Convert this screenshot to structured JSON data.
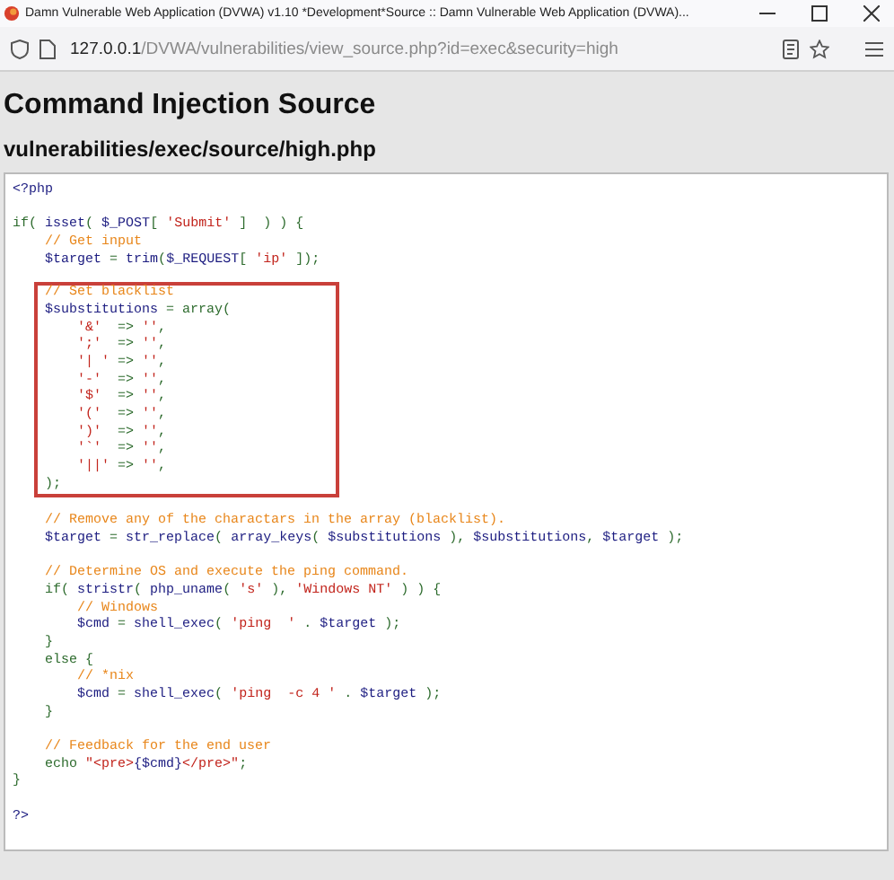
{
  "window": {
    "title": "Damn Vulnerable Web Application (DVWA) v1.10 *Development*Source :: Damn Vulnerable Web Application (DVWA)..."
  },
  "address_bar": {
    "host": "127.0.0.1",
    "path": "/DVWA/vulnerabilities/view_source.php?id=exec&security=high"
  },
  "page": {
    "heading": "Command Injection Source",
    "file_path": "vulnerabilities/exec/source/high.php"
  },
  "code": {
    "blocks": [
      {
        "kind": "plain",
        "lines": [
          {
            "tokens": [
              {
                "kind": "code",
                "text": "<?php"
              }
            ]
          },
          {
            "gap_before": true,
            "tokens": [
              {
                "kind": "keyword",
                "text": "if( "
              },
              {
                "kind": "code",
                "text": "isset"
              },
              {
                "kind": "keyword",
                "text": "( "
              },
              {
                "kind": "code",
                "text": "$_POST"
              },
              {
                "kind": "keyword",
                "text": "[ "
              },
              {
                "kind": "string",
                "text": "'Submit'"
              },
              {
                "kind": "keyword",
                "text": " ]  ) ) {"
              }
            ]
          },
          {
            "tokens": [
              {
                "kind": "comment",
                "text": "    // Get input"
              }
            ]
          },
          {
            "tokens": [
              {
                "kind": "code",
                "text": "    $target "
              },
              {
                "kind": "keyword",
                "text": "= "
              },
              {
                "kind": "code",
                "text": "trim"
              },
              {
                "kind": "keyword",
                "text": "("
              },
              {
                "kind": "code",
                "text": "$_REQUEST"
              },
              {
                "kind": "keyword",
                "text": "[ "
              },
              {
                "kind": "string",
                "text": "'ip'"
              },
              {
                "kind": "keyword",
                "text": " ]);"
              }
            ]
          }
        ]
      },
      {
        "kind": "boxed",
        "gap_before": true,
        "lines": [
          {
            "tokens": [
              {
                "kind": "comment",
                "text": "    // Set blacklist"
              }
            ]
          },
          {
            "tokens": [
              {
                "kind": "code",
                "text": "    $substitutions "
              },
              {
                "kind": "keyword",
                "text": "= array("
              }
            ]
          },
          {
            "tokens": [
              {
                "kind": "string",
                "text": "        '&'"
              },
              {
                "kind": "keyword",
                "text": "  => "
              },
              {
                "kind": "string",
                "text": "''"
              },
              {
                "kind": "keyword",
                "text": ","
              }
            ]
          },
          {
            "tokens": [
              {
                "kind": "string",
                "text": "        ';'"
              },
              {
                "kind": "keyword",
                "text": "  => "
              },
              {
                "kind": "string",
                "text": "''"
              },
              {
                "kind": "keyword",
                "text": ","
              }
            ]
          },
          {
            "tokens": [
              {
                "kind": "string",
                "text": "        '| '"
              },
              {
                "kind": "keyword",
                "text": " => "
              },
              {
                "kind": "string",
                "text": "''"
              },
              {
                "kind": "keyword",
                "text": ","
              }
            ]
          },
          {
            "tokens": [
              {
                "kind": "string",
                "text": "        '-'"
              },
              {
                "kind": "keyword",
                "text": "  => "
              },
              {
                "kind": "string",
                "text": "''"
              },
              {
                "kind": "keyword",
                "text": ","
              }
            ]
          },
          {
            "tokens": [
              {
                "kind": "string",
                "text": "        '$'"
              },
              {
                "kind": "keyword",
                "text": "  => "
              },
              {
                "kind": "string",
                "text": "''"
              },
              {
                "kind": "keyword",
                "text": ","
              }
            ]
          },
          {
            "tokens": [
              {
                "kind": "string",
                "text": "        '('"
              },
              {
                "kind": "keyword",
                "text": "  => "
              },
              {
                "kind": "string",
                "text": "''"
              },
              {
                "kind": "keyword",
                "text": ","
              }
            ]
          },
          {
            "tokens": [
              {
                "kind": "string",
                "text": "        ')'"
              },
              {
                "kind": "keyword",
                "text": "  => "
              },
              {
                "kind": "string",
                "text": "''"
              },
              {
                "kind": "keyword",
                "text": ","
              }
            ]
          },
          {
            "tokens": [
              {
                "kind": "string",
                "text": "        '`'"
              },
              {
                "kind": "keyword",
                "text": "  => "
              },
              {
                "kind": "string",
                "text": "''"
              },
              {
                "kind": "keyword",
                "text": ","
              }
            ]
          },
          {
            "tokens": [
              {
                "kind": "string",
                "text": "        '||'"
              },
              {
                "kind": "keyword",
                "text": " => "
              },
              {
                "kind": "string",
                "text": "''"
              },
              {
                "kind": "keyword",
                "text": ","
              }
            ]
          },
          {
            "tokens": [
              {
                "kind": "keyword",
                "text": "    );"
              }
            ]
          }
        ]
      },
      {
        "kind": "plain",
        "gap_before": true,
        "lines": [
          {
            "tokens": [
              {
                "kind": "comment",
                "text": "    // Remove any of the charactars in the array (blacklist)."
              }
            ]
          },
          {
            "tokens": [
              {
                "kind": "code",
                "text": "    $target "
              },
              {
                "kind": "keyword",
                "text": "= "
              },
              {
                "kind": "code",
                "text": "str_replace"
              },
              {
                "kind": "keyword",
                "text": "( "
              },
              {
                "kind": "code",
                "text": "array_keys"
              },
              {
                "kind": "keyword",
                "text": "( "
              },
              {
                "kind": "code",
                "text": "$substitutions "
              },
              {
                "kind": "keyword",
                "text": "), "
              },
              {
                "kind": "code",
                "text": "$substitutions"
              },
              {
                "kind": "keyword",
                "text": ", "
              },
              {
                "kind": "code",
                "text": "$target "
              },
              {
                "kind": "keyword",
                "text": ");"
              }
            ]
          },
          {
            "gap_before": true,
            "tokens": [
              {
                "kind": "comment",
                "text": "    // Determine OS and execute the ping command."
              }
            ]
          },
          {
            "tokens": [
              {
                "kind": "keyword",
                "text": "    if( "
              },
              {
                "kind": "code",
                "text": "stristr"
              },
              {
                "kind": "keyword",
                "text": "( "
              },
              {
                "kind": "code",
                "text": "php_uname"
              },
              {
                "kind": "keyword",
                "text": "( "
              },
              {
                "kind": "string",
                "text": "'s'"
              },
              {
                "kind": "keyword",
                "text": " ), "
              },
              {
                "kind": "string",
                "text": "'Windows NT'"
              },
              {
                "kind": "keyword",
                "text": " ) ) {"
              }
            ]
          },
          {
            "tokens": [
              {
                "kind": "comment",
                "text": "        // Windows"
              }
            ]
          },
          {
            "tokens": [
              {
                "kind": "code",
                "text": "        $cmd "
              },
              {
                "kind": "keyword",
                "text": "= "
              },
              {
                "kind": "code",
                "text": "shell_exec"
              },
              {
                "kind": "keyword",
                "text": "( "
              },
              {
                "kind": "string",
                "text": "'ping  '"
              },
              {
                "kind": "keyword",
                "text": " . "
              },
              {
                "kind": "code",
                "text": "$target "
              },
              {
                "kind": "keyword",
                "text": ");"
              }
            ]
          },
          {
            "tokens": [
              {
                "kind": "keyword",
                "text": "    }"
              }
            ]
          },
          {
            "tokens": [
              {
                "kind": "keyword",
                "text": "    else {"
              }
            ]
          },
          {
            "tokens": [
              {
                "kind": "comment",
                "text": "        // *nix"
              }
            ]
          },
          {
            "tokens": [
              {
                "kind": "code",
                "text": "        $cmd "
              },
              {
                "kind": "keyword",
                "text": "= "
              },
              {
                "kind": "code",
                "text": "shell_exec"
              },
              {
                "kind": "keyword",
                "text": "( "
              },
              {
                "kind": "string",
                "text": "'ping  -c 4 '"
              },
              {
                "kind": "keyword",
                "text": " . "
              },
              {
                "kind": "code",
                "text": "$target "
              },
              {
                "kind": "keyword",
                "text": ");"
              }
            ]
          },
          {
            "tokens": [
              {
                "kind": "keyword",
                "text": "    }"
              }
            ]
          },
          {
            "gap_before": true,
            "tokens": [
              {
                "kind": "comment",
                "text": "    // Feedback for the end user"
              }
            ]
          },
          {
            "tokens": [
              {
                "kind": "keyword",
                "text": "    echo "
              },
              {
                "kind": "string",
                "text": "\"<pre>"
              },
              {
                "kind": "code",
                "text": "{$cmd}"
              },
              {
                "kind": "string",
                "text": "</pre>\""
              },
              {
                "kind": "keyword",
                "text": ";"
              }
            ]
          },
          {
            "tokens": [
              {
                "kind": "keyword",
                "text": "}"
              }
            ]
          },
          {
            "gap_before": true,
            "tokens": [
              {
                "kind": "code",
                "text": "?>"
              }
            ]
          }
        ]
      }
    ]
  }
}
